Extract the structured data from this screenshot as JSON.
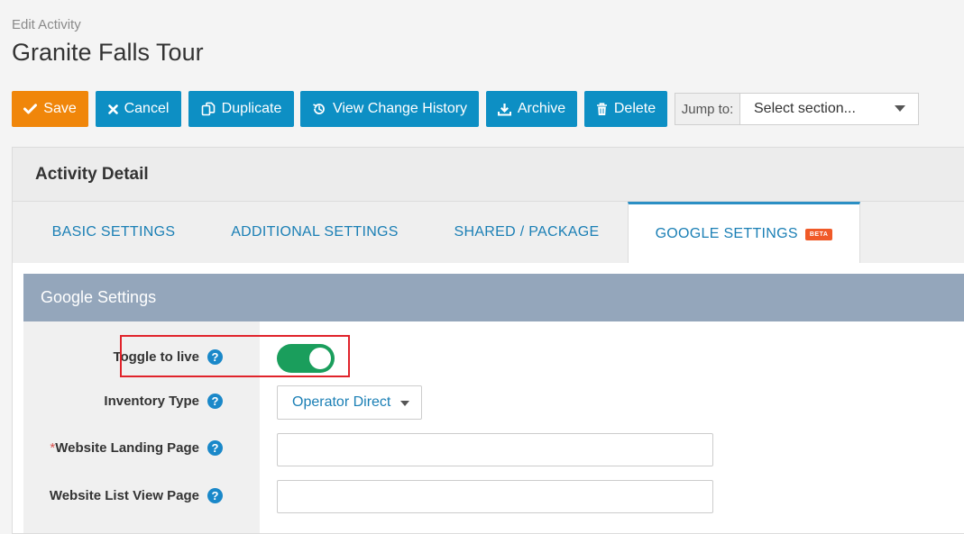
{
  "header": {
    "eyebrow": "Edit Activity",
    "title": "Granite Falls Tour"
  },
  "toolbar": {
    "save": {
      "label": "Save",
      "icon": "check-icon",
      "color": "#f0860a"
    },
    "cancel": {
      "label": "Cancel",
      "icon": "close-icon",
      "color": "#0d8fc4"
    },
    "duplicate": {
      "label": "Duplicate",
      "icon": "copy-icon",
      "color": "#0d8fc4"
    },
    "history": {
      "label": "View Change History",
      "icon": "history-icon",
      "color": "#0d8fc4"
    },
    "archive": {
      "label": "Archive",
      "icon": "download-icon",
      "color": "#0d8fc4"
    },
    "delete": {
      "label": "Delete",
      "icon": "trash-icon",
      "color": "#0d8fc4"
    },
    "jump": {
      "label": "Jump to:",
      "value": "Select section..."
    }
  },
  "panel": {
    "title": "Activity Detail",
    "tabs": [
      {
        "label": "BASIC SETTINGS",
        "active": false
      },
      {
        "label": "ADDITIONAL SETTINGS",
        "active": false
      },
      {
        "label": "SHARED / PACKAGE",
        "active": false
      },
      {
        "label": "GOOGLE SETTINGS",
        "active": true,
        "badge": "BETA"
      }
    ]
  },
  "google_settings": {
    "title": "Google Settings",
    "fields": {
      "toggle_live": {
        "label": "Toggle to live",
        "value": "on"
      },
      "inventory_type": {
        "label": "Inventory Type",
        "value": "Operator Direct"
      },
      "landing_page": {
        "required_mark": "*",
        "label": "Website Landing Page",
        "value": ""
      },
      "list_view_page": {
        "label": "Website List View Page",
        "value": ""
      }
    },
    "help_glyph": "?"
  }
}
